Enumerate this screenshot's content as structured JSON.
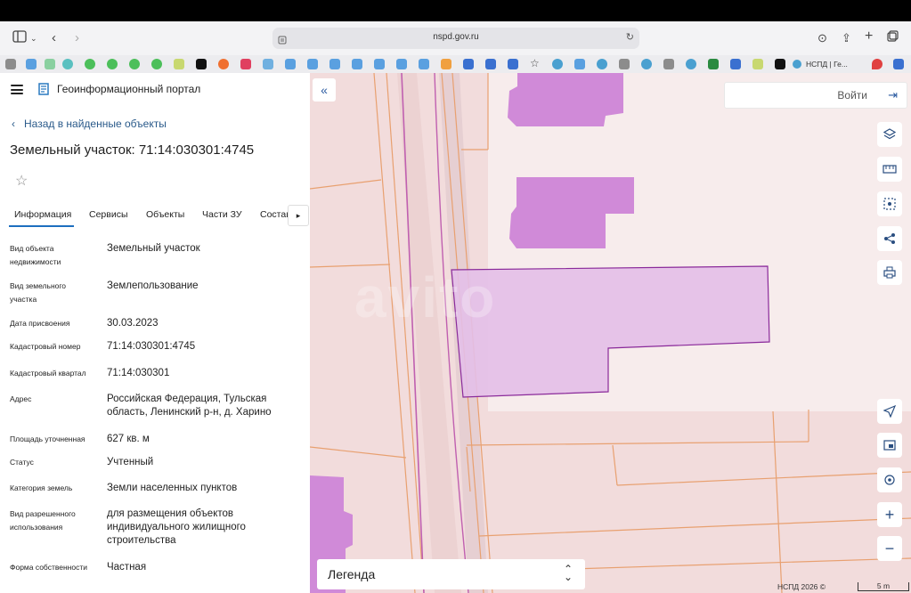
{
  "browser": {
    "url": "nspd.gov.ru",
    "active_tab_title": "НСПД | Ге..."
  },
  "header": {
    "portal_title": "Геоинформационный портал"
  },
  "panel": {
    "back_label": "Назад в найденные объекты",
    "object_title": "Земельный участок: 71:14:030301:4745",
    "tabs": [
      {
        "label": "Информация"
      },
      {
        "label": "Сервисы"
      },
      {
        "label": "Объекты"
      },
      {
        "label": "Части ЗУ"
      },
      {
        "label": "Состав"
      }
    ],
    "fields": [
      {
        "label": "Вид объекта недвижимости",
        "value": "Земельный участок"
      },
      {
        "label": "Вид земельного участка",
        "value": "Землепользование"
      },
      {
        "label": "Дата присвоения",
        "value": "30.03.2023"
      },
      {
        "label": "Кадастровый номер",
        "value": "71:14:030301:4745"
      },
      {
        "label": "Кадастровый квартал",
        "value": "71:14:030301"
      },
      {
        "label": "Адрес",
        "value": "Российская Федерация, Тульская область, Ленинский р-н, д. Харино"
      },
      {
        "label": "Площадь уточненная",
        "value": "627 кв. м"
      },
      {
        "label": "Статус",
        "value": "Учтенный"
      },
      {
        "label": "Категория земель",
        "value": "Земли населенных пунктов"
      },
      {
        "label": "Вид разрешенного использования",
        "value": "для размещения объектов индивидуального жилищного строительства"
      },
      {
        "label": "Форма собственности",
        "value": "Частная"
      }
    ]
  },
  "map": {
    "login_label": "Войти",
    "legend_label": "Легенда",
    "attribution": "НСПД 2026 ©",
    "scale_label": "5 m",
    "watermark": "avito",
    "colors": {
      "background": "#f2dcdc",
      "building": "#d08ad8",
      "selected_parcel": "#e3bfe8",
      "selected_outline": "#8a2a9a",
      "boundary": "#e8a070"
    },
    "controls": [
      "layers-icon",
      "ruler-icon",
      "select-area-icon",
      "share-icon",
      "print-icon",
      "locate-icon",
      "minimap-icon",
      "gps-icon",
      "zoom-in-icon",
      "zoom-out-icon"
    ]
  }
}
